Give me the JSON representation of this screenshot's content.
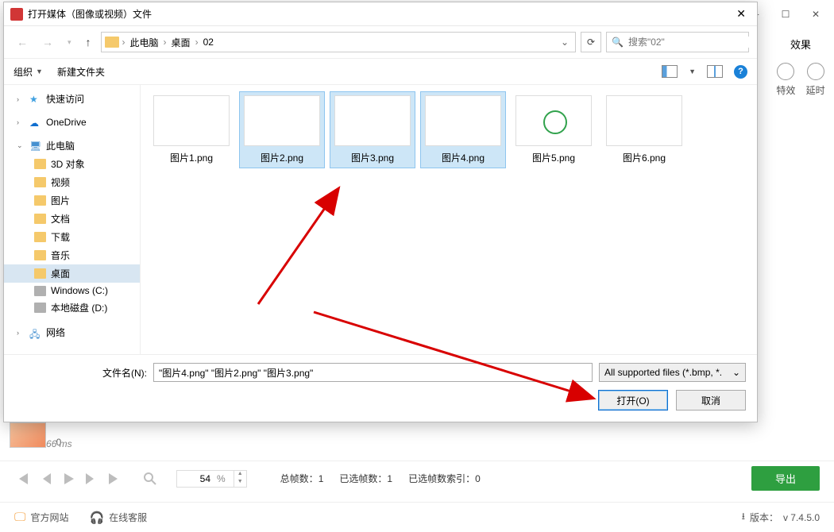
{
  "app": {
    "right_panel": {
      "title": "效果",
      "effects": [
        "特效",
        "延时"
      ]
    }
  },
  "thumb": {
    "index": "0",
    "time": "66 ms"
  },
  "playback": {
    "zoom_value": "54",
    "zoom_unit": "%",
    "stats": {
      "total_label": "总帧数：",
      "total": "1",
      "sel_label": "已选帧数：",
      "sel": "1",
      "idx_label": "已选帧数索引：",
      "idx": "0"
    },
    "export": "导出"
  },
  "footer": {
    "site": "官方网站",
    "support": "在线客服",
    "version_label": "版本：",
    "version": "v 7.4.5.0"
  },
  "dialog": {
    "title": "打开媒体（图像或视频）文件",
    "breadcrumbs": [
      "此电脑",
      "桌面",
      "02"
    ],
    "search_placeholder": "搜索\"02\"",
    "toolbar": {
      "organize": "组织",
      "new_folder": "新建文件夹"
    },
    "sidebar": {
      "quick": "快速访问",
      "onedrive": "OneDrive",
      "this_pc": "此电脑",
      "children": [
        "3D 对象",
        "视频",
        "图片",
        "文档",
        "下载",
        "音乐",
        "桌面",
        "Windows (C:)",
        "本地磁盘 (D:)"
      ],
      "network": "网络"
    },
    "files": [
      {
        "name": "图片1.png",
        "selected": false,
        "pv": "pv1"
      },
      {
        "name": "图片2.png",
        "selected": true,
        "pv": "pv2"
      },
      {
        "name": "图片3.png",
        "selected": true,
        "pv": "pv3"
      },
      {
        "name": "图片4.png",
        "selected": true,
        "pv": "pv4"
      },
      {
        "name": "图片5.png",
        "selected": false,
        "pv": "pv5"
      },
      {
        "name": "图片6.png",
        "selected": false,
        "pv": "pv6"
      }
    ],
    "filename_label": "文件名(N):",
    "filename_value": "\"图片4.png\" \"图片2.png\" \"图片3.png\"",
    "filetype": "All supported files (*.bmp, *.",
    "open": "打开(O)",
    "cancel": "取消"
  }
}
